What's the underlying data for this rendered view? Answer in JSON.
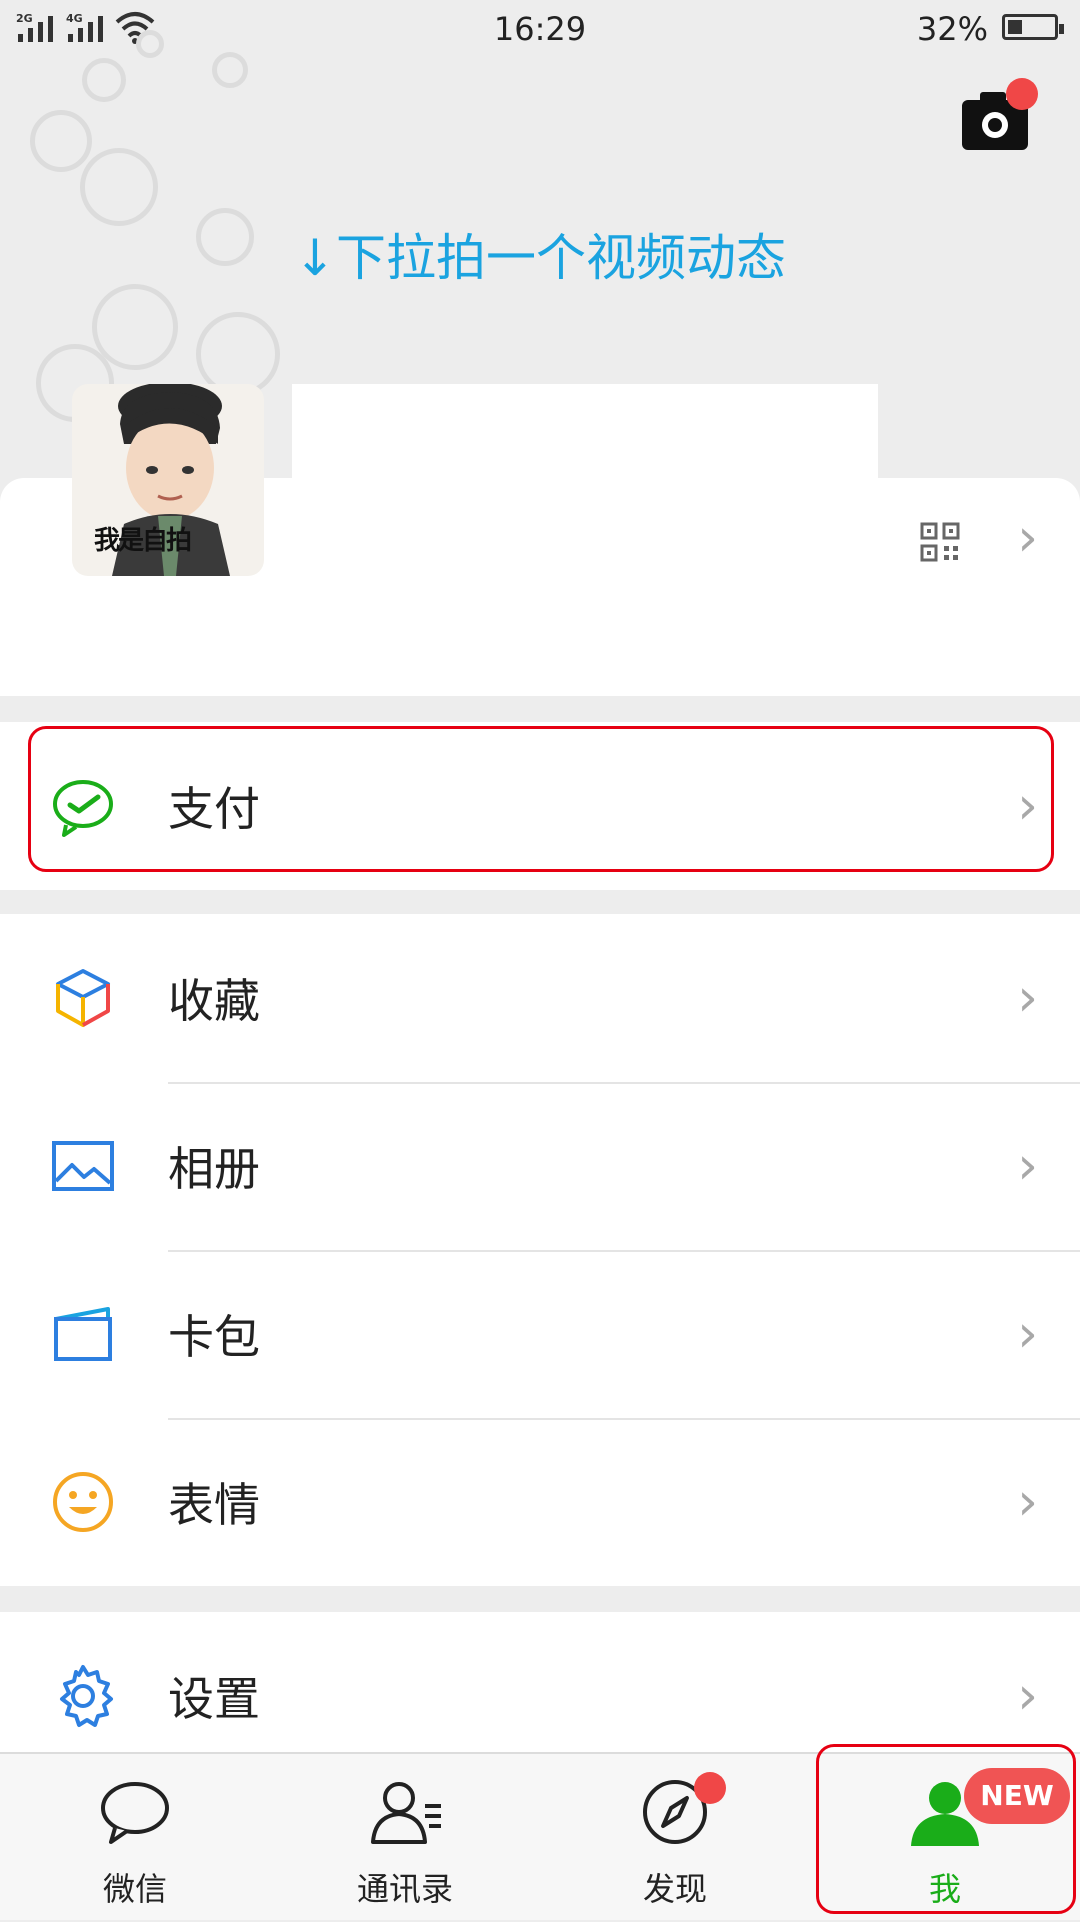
{
  "status_bar": {
    "signal1_label": "2G",
    "signal2_label": "4G",
    "time": "16:29",
    "battery_percent": "32%",
    "battery_level": 0.32
  },
  "header": {
    "pull_hint": "↓下拉拍一个视频动态",
    "camera_icon": "camera-icon",
    "camera_has_badge": true
  },
  "profile": {
    "avatar_text": "我是自拍",
    "qr_icon": "qrcode-icon",
    "chevron_icon": "chevron-right-icon"
  },
  "menu": {
    "pay": {
      "label": "支付",
      "icon": "wechat-pay-icon",
      "color": "#1aad19"
    },
    "items": [
      {
        "label": "收藏",
        "icon": "favorites-cube-icon"
      },
      {
        "label": "相册",
        "icon": "album-picture-icon"
      },
      {
        "label": "卡包",
        "icon": "card-wallet-icon"
      },
      {
        "label": "表情",
        "icon": "emoji-smile-icon"
      }
    ],
    "settings": {
      "label": "设置",
      "icon": "gear-icon"
    }
  },
  "tabbar": {
    "tabs": [
      {
        "label": "微信",
        "icon": "chat-bubble-icon"
      },
      {
        "label": "通讯录",
        "icon": "contacts-icon"
      },
      {
        "label": "发现",
        "icon": "compass-icon"
      },
      {
        "label": "我",
        "icon": "person-icon"
      }
    ],
    "active_index": 3,
    "new_badge": "NEW",
    "accent": "#1aad19",
    "highlight": "#e60012"
  }
}
